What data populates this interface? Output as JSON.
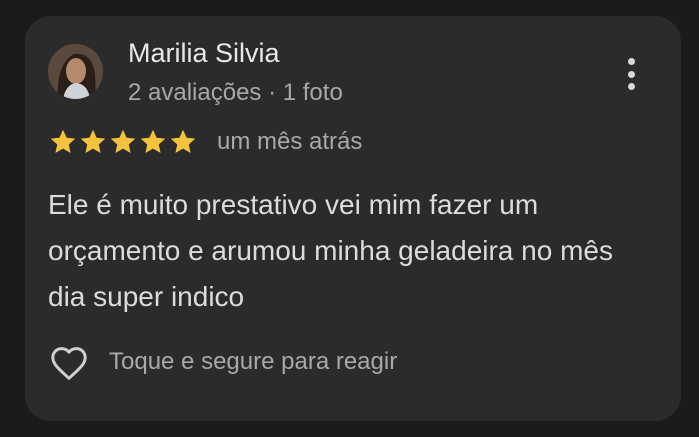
{
  "review": {
    "author_name": "Marilia Silvia",
    "author_meta": "2 avaliações · 1 foto",
    "rating": 5,
    "rating_max": 5,
    "date": "um mês atrás",
    "text": "Ele é muito prestativo vei mim fazer um orçamento e arumou minha geladeira no mês dia super indico",
    "react_hint": "Toque e segure para reagir",
    "star_color": "#f5c33b",
    "icons": {
      "menu": "more-vert-icon",
      "star": "star-icon",
      "react": "heart-outline-icon"
    }
  }
}
